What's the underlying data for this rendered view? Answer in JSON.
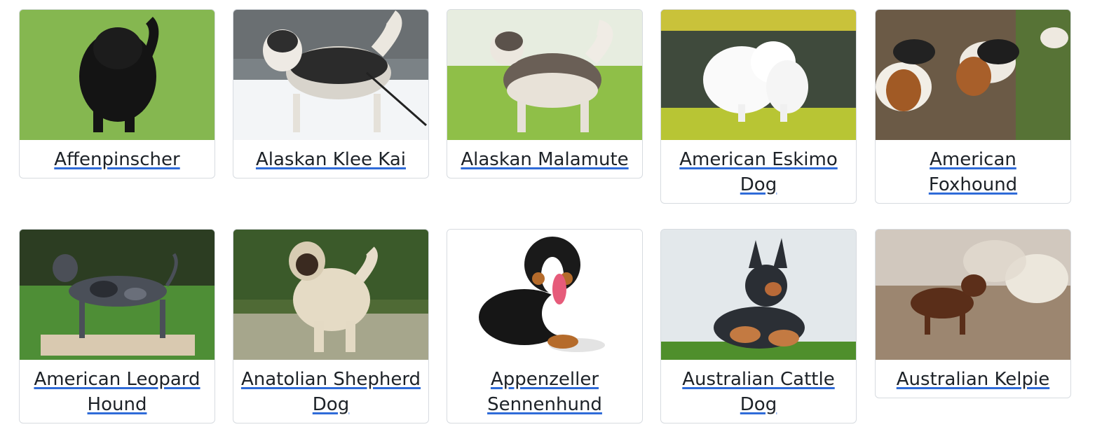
{
  "breeds": [
    {
      "name": "Affenpinscher",
      "image": "black-shaggy-dog-on-grass"
    },
    {
      "name": "Alaskan Klee Kai",
      "image": "husky-type-dog-in-snow-with-harness"
    },
    {
      "name": "Alaskan Malamute",
      "image": "malamute-standing-on-grass"
    },
    {
      "name": "American Eskimo Dog",
      "image": "white-fluffy-dog-on-grass"
    },
    {
      "name": "American Foxhound",
      "image": "foxhounds-on-dirt-ground"
    },
    {
      "name": "American Leopard Hound",
      "image": "merle-hound-standing-on-table"
    },
    {
      "name": "Anatolian Shepherd Dog",
      "image": "large-cream-dog-in-field"
    },
    {
      "name": "Appenzeller Sennenhund",
      "image": "tricolor-dog-lying-white-background"
    },
    {
      "name": "Australian Cattle Dog",
      "image": "blue-heeler-lying-on-grass"
    },
    {
      "name": "Australian Kelpie",
      "image": "brown-dog-running-near-sheep"
    }
  ],
  "colors": {
    "link_underline": "#2f6bd8",
    "card_border": "#d7dbe0"
  }
}
